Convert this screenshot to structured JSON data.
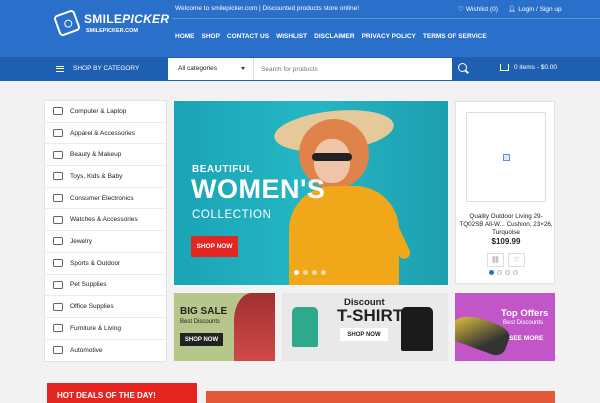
{
  "brand": {
    "name_main": "SMILE",
    "name_accent": "PICKER",
    "url": "SMILEPICKER.COM"
  },
  "topbar": {
    "welcome": "Welcome to smilepicker.com | Discounted products store online!",
    "wishlist": "Wishlist (0)",
    "login": "Login / Sign up"
  },
  "nav": [
    "HOME",
    "SHOP",
    "CONTACT US",
    "WISHLIST",
    "DISCLAIMER",
    "PRIVACY POLICY",
    "TERMS OF SERVICE"
  ],
  "search": {
    "shop_by_category": "SHOP BY CATEGORY",
    "category_value": "All categories",
    "placeholder": "Search for products",
    "cart": "0 items - $0.00"
  },
  "categories": [
    {
      "label": "Computer & Laptop",
      "icon": "laptop-icon"
    },
    {
      "label": "Apparel & Accessories",
      "icon": "shirt-icon"
    },
    {
      "label": "Beauty & Makeup",
      "icon": "lipstick-icon"
    },
    {
      "label": "Toys, Kids & Baby",
      "icon": "stroller-icon"
    },
    {
      "label": "Consumer Electronics",
      "icon": "chip-icon"
    },
    {
      "label": "Watches & Accessories",
      "icon": "watch-icon"
    },
    {
      "label": "Jewelry",
      "icon": "diamond-icon"
    },
    {
      "label": "Sports & Outdoor",
      "icon": "ball-icon"
    },
    {
      "label": "Pet Supplies",
      "icon": "paw-icon"
    },
    {
      "label": "Office Supplies",
      "icon": "printer-icon"
    },
    {
      "label": "Furniture & Living",
      "icon": "sofa-icon"
    },
    {
      "label": "Automotive",
      "icon": "car-icon"
    }
  ],
  "hero": {
    "line1": "BEAUTIFUL",
    "line2": "WOMEN'S",
    "line3": "COLLECTION",
    "button": "SHOP NOW",
    "active_slide": 1,
    "slide_count": 4
  },
  "product": {
    "title": "Quality Outdoor Living 29-TQ02SB All-W... Cushion, 23×26, Turquoise",
    "price": "$109.99"
  },
  "banners": {
    "big_sale": {
      "title": "BIG SALE",
      "subtitle": "Best Discounts",
      "button": "SHOP NOW"
    },
    "tshirt": {
      "title1": "Discount",
      "title2": "T-SHIRT",
      "button": "SHOP NOW"
    },
    "top_offers": {
      "title": "Top Offers",
      "subtitle": "Best Discounts",
      "button": "SEE MORE"
    }
  },
  "hot_deals": "HOT DEALS OF THE DAY!",
  "colors": {
    "brand_blue": "#2a6fc9",
    "accent_red": "#e5251f"
  }
}
